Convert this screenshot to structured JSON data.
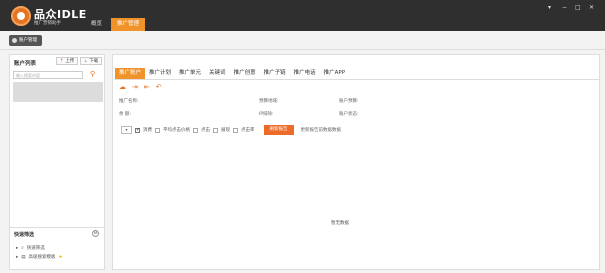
{
  "app": {
    "brand_name": "品众IDLE",
    "brand_sub": "推广营销助手",
    "nav": {
      "overview": "概览",
      "promotion": "推广管理"
    },
    "window_controls": {
      "menu": "▾",
      "minimize": "−",
      "maximize": "□",
      "close": "✕"
    }
  },
  "toolbar": {
    "account_mgmt": "账户管理"
  },
  "left_panel": {
    "title": "账户列表",
    "upload": "上传",
    "download": "下载",
    "search_placeholder": "输入搜索内容",
    "quick_filter": {
      "title": "快速筛选",
      "toggle": "⊖",
      "items": [
        "快速筛选",
        "高级搜索模板"
      ]
    }
  },
  "main": {
    "tabs": [
      "推广账户",
      "推广计划",
      "推广单元",
      "关键词",
      "推广创意",
      "推广子链",
      "推广电话",
      "推广APP"
    ],
    "active_tab": 0,
    "fields": {
      "account_name": "推广名称:",
      "balance": "余    额:",
      "budget": "预算地域:",
      "daily": "IP排除:",
      "account_budget": "账户预算:",
      "account_status": "账户状态:"
    },
    "filter": {
      "select": "▾",
      "options": [
        "消费",
        "平均点击价格",
        "点击",
        "展现",
        "点击率"
      ],
      "checked": [
        true,
        false,
        false,
        false,
        false
      ],
      "refresh_button": "刷新报告",
      "refresh_note": "更新报告前数据数据"
    },
    "empty_text": "暂无数据"
  },
  "colors": {
    "accent": "#f0932b",
    "titlebar": "#2f2f2f",
    "refresh": "#ec6b29"
  }
}
